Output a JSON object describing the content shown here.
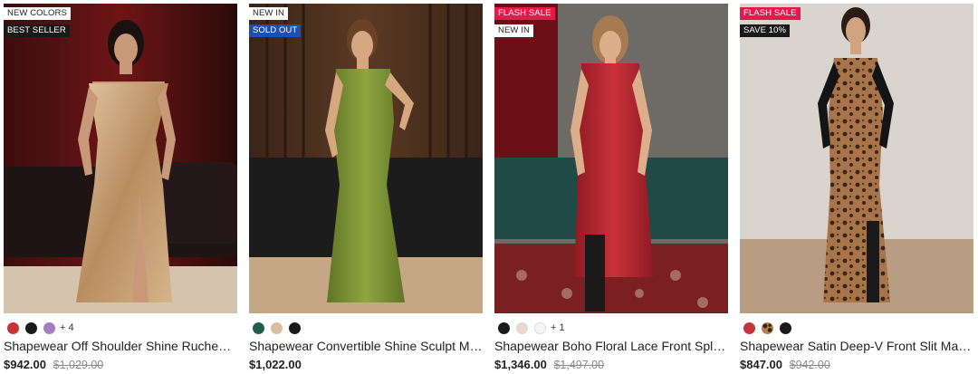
{
  "products": [
    {
      "badges": [
        "NEW COLORS",
        "BEST SELLER"
      ],
      "badge_styles": [
        "white",
        "black"
      ],
      "swatches": [
        "#c8323a",
        "#1a1a1a",
        "#a57cc0"
      ],
      "more_colors": "+ 4",
      "title": "Shapewear Off Shoulder Shine Ruched Split Maxi Dress",
      "price": "$942.00",
      "original_price": "$1,029.00",
      "dress_color": "#c9a67e"
    },
    {
      "badges": [
        "NEW IN",
        "SOLD OUT"
      ],
      "badge_styles": [
        "white",
        "blue"
      ],
      "swatches": [
        "#1f5e4a",
        "#d9bea3",
        "#1a1a1a"
      ],
      "more_colors": "",
      "title": "Shapewear Convertible Shine Sculpt Maxi Dress",
      "price": "$1,022.00",
      "original_price": "",
      "dress_color": "#7a9134"
    },
    {
      "badges": [
        "FLASH SALE",
        "NEW IN"
      ],
      "badge_styles": [
        "red",
        "white"
      ],
      "swatches": [
        "#1a1a1a",
        "#e9d8cc",
        "#f5f5f5"
      ],
      "more_colors": "+ 1",
      "title": "Shapewear Boho Floral Lace Front Split Maxi Dress",
      "price": "$1,346.00",
      "original_price": "$1,497.00",
      "dress_color": "#b5232c"
    },
    {
      "badges": [
        "FLASH SALE",
        "SAVE 10%"
      ],
      "badge_styles": [
        "red",
        "black"
      ],
      "swatches": [
        "#c8323a",
        "leopard",
        "#1a1a1a"
      ],
      "more_colors": "",
      "title": "Shapewear Satin Deep-V Front Slit Maxi Dress",
      "price": "$847.00",
      "original_price": "$942.00",
      "dress_color": "#8a5a36"
    }
  ]
}
